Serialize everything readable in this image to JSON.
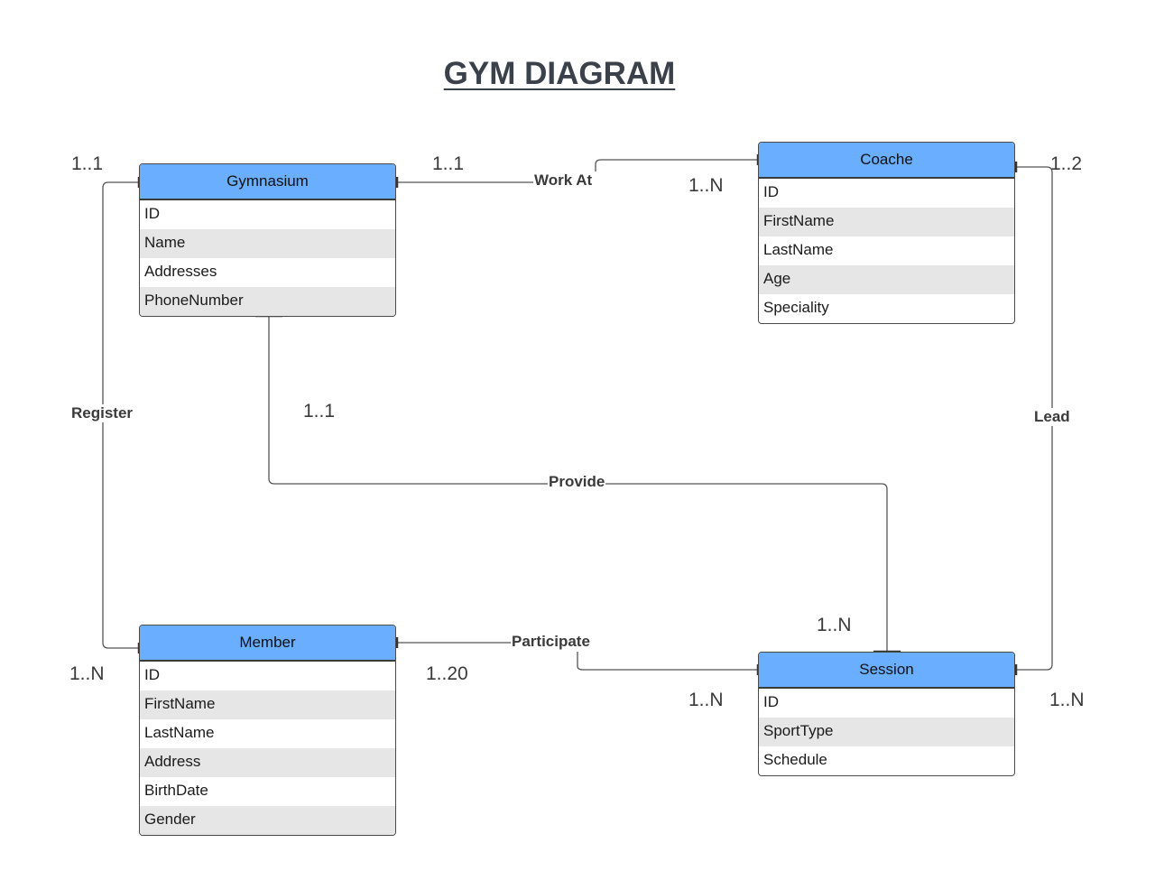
{
  "title": "GYM DIAGRAM",
  "entities": {
    "gymnasium": {
      "name": "Gymnasium",
      "fields": [
        "ID",
        "Name",
        "Addresses",
        "PhoneNumber"
      ]
    },
    "coache": {
      "name": "Coache",
      "fields": [
        "ID",
        "FirstName",
        "LastName",
        "Age",
        "Speciality"
      ]
    },
    "member": {
      "name": "Member",
      "fields": [
        "ID",
        "FirstName",
        "LastName",
        "Address",
        "BirthDate",
        "Gender"
      ]
    },
    "session": {
      "name": "Session",
      "fields": [
        "ID",
        "SportType",
        "Schedule"
      ]
    }
  },
  "relationships": {
    "work_at": "Work At",
    "register": "Register",
    "provide": "Provide",
    "participate": "Participate",
    "lead": "Lead"
  },
  "cardinalities": {
    "gym_register": "1..1",
    "gym_workat": "1..1",
    "coache_workat": "1..N",
    "coache_lead": "1..2",
    "gym_provide": "1..1",
    "session_provide": "1..N",
    "member_register": "1..N",
    "member_participate": "1..20",
    "session_participate": "1..N",
    "session_lead": "1..N"
  },
  "colors": {
    "header": "#6aaeff",
    "row_alt": "#e6e6e6",
    "line": "#555555"
  }
}
